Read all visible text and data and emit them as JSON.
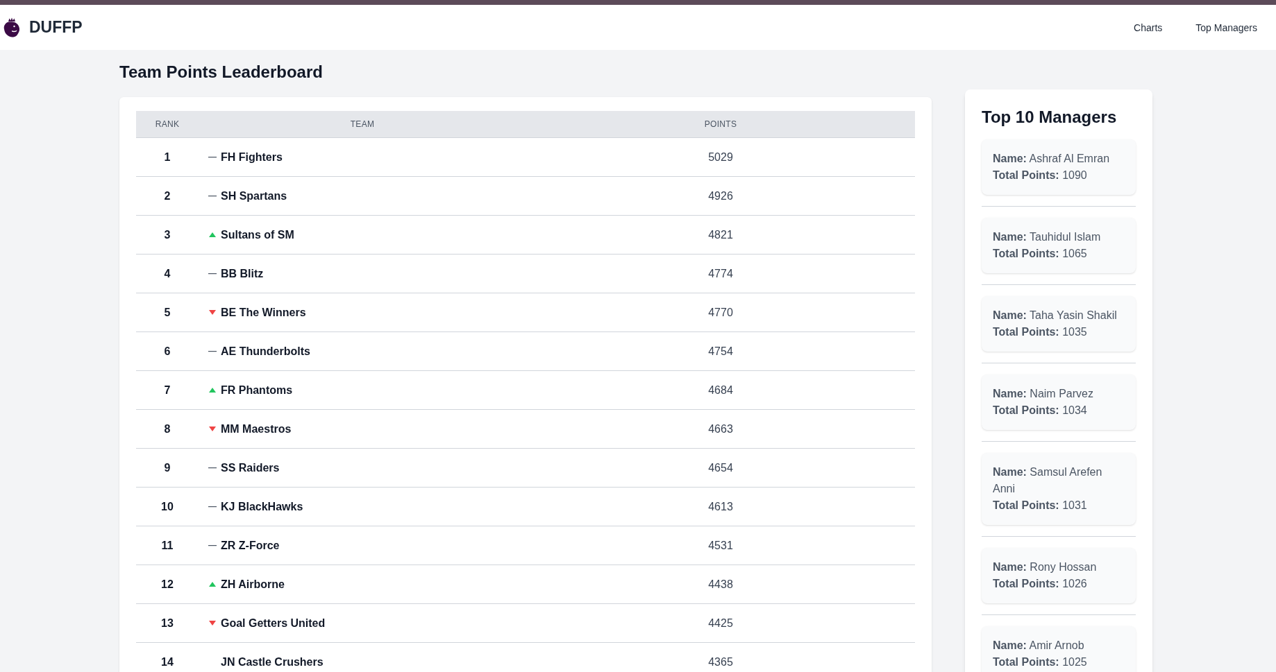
{
  "header": {
    "brand": "DUFFP",
    "nav": [
      {
        "label": "Charts"
      },
      {
        "label": "Top Managers"
      }
    ]
  },
  "leaderboard": {
    "title": "Team Points Leaderboard",
    "columns": [
      "RANK",
      "TEAM",
      "POINTS"
    ],
    "rows": [
      {
        "rank": "1",
        "kind": "same",
        "team": "FH Fighters",
        "points": "5029"
      },
      {
        "rank": "2",
        "kind": "same",
        "team": "SH Spartans",
        "points": "4926"
      },
      {
        "rank": "3",
        "kind": "up",
        "team": "Sultans of SM",
        "points": "4821"
      },
      {
        "rank": "4",
        "kind": "same",
        "team": "BB Blitz",
        "points": "4774"
      },
      {
        "rank": "5",
        "kind": "down",
        "team": "BE The Winners",
        "points": "4770"
      },
      {
        "rank": "6",
        "kind": "same",
        "team": "AE Thunderbolts",
        "points": "4754"
      },
      {
        "rank": "7",
        "kind": "up",
        "team": "FR Phantoms",
        "points": "4684"
      },
      {
        "rank": "8",
        "kind": "down",
        "team": "MM Maestros",
        "points": "4663"
      },
      {
        "rank": "9",
        "kind": "same",
        "team": "SS Raiders",
        "points": "4654"
      },
      {
        "rank": "10",
        "kind": "same",
        "team": "KJ BlackHawks",
        "points": "4613"
      },
      {
        "rank": "11",
        "kind": "same",
        "team": "ZR Z-Force",
        "points": "4531"
      },
      {
        "rank": "12",
        "kind": "up",
        "team": "ZH Airborne",
        "points": "4438"
      },
      {
        "rank": "13",
        "kind": "down",
        "team": "Goal Getters United",
        "points": "4425"
      },
      {
        "rank": "14",
        "team": "JN Castle Crushers",
        "points": "4365"
      }
    ]
  },
  "managers_panel": {
    "title": "Top 10 Managers",
    "managers": [
      {
        "name_line": "**Name:** Ashraf Al Emran",
        "points_line": "**Total Points:** 1090"
      },
      {
        "name_line": "**Name:** Tauhidul Islam",
        "points_line": "**Total Points:** 1065"
      },
      {
        "name_line": "**Name:** Taha Yasin Shakil",
        "points_line": "**Total Points:** 1035"
      },
      {
        "name_line": "**Name:** Naim Parvez",
        "points_line": "**Total Points:** 1034"
      },
      {
        "name_line": "**Name:** Samsul Arefen Anni",
        "points_line": "**Total Points:** 1031"
      },
      {
        "name_line": "**Name:** Rony Hossan",
        "points_line": "**Total Points:** 1026"
      },
      {
        "name_line": "**Name:** Amir Arnob",
        "points_line": "**Total Points:** 1025"
      }
    ]
  }
}
